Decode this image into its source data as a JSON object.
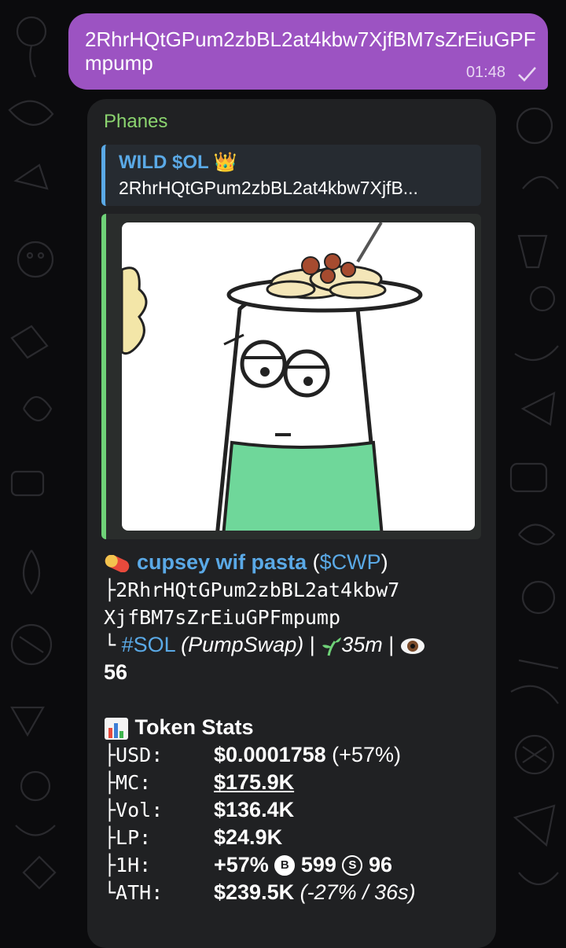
{
  "outgoing": {
    "text": "2RhrHQtGPum2zbBL2at4kbw7XjfBM7sZrEiuGPFmpump",
    "time": "01:48"
  },
  "incoming": {
    "sender": "Phanes",
    "reply": {
      "title": "WILD $OL",
      "title_emoji": "👑",
      "text": "2RhrHQtGPum2zbBL2at4kbw7XjfB..."
    },
    "token": {
      "name": "cupsey wif pasta",
      "ticker_open": "(",
      "ticker": "$CWP",
      "ticker_close": ")",
      "addr_prefix": "├",
      "address_line1": "2RhrHQtGPum2zbBL2at4kbw7",
      "address_line2": "XjfBM7sZrEiuGPFmpump",
      "chain_prefix": "└",
      "chain": "#SOL",
      "dex": "(PumpSwap)",
      "sep": "|",
      "age": "35m",
      "views": "56"
    },
    "stats": {
      "title": "Token Stats",
      "rows": [
        {
          "key": "├USD:",
          "value": "$0.0001758",
          "extra": "(+57%)"
        },
        {
          "key": "├MC:",
          "value": "$175.9K",
          "extra": ""
        },
        {
          "key": "├Vol:",
          "value": "$136.4K",
          "extra": ""
        },
        {
          "key": "├LP:",
          "value": "$24.9K",
          "extra": ""
        },
        {
          "key": "├1H:",
          "value": "+57%",
          "buys": "599",
          "sells": "96"
        },
        {
          "key": "└ATH:",
          "value": "$239.5K",
          "extra": "(-27% / 36s)"
        }
      ],
      "buy_icon": "B",
      "sell_icon": "S"
    }
  },
  "colors": {
    "outgoing_bubble": "#9c53c2",
    "incoming_bubble": "#202123",
    "sender": "#8bd46f",
    "link": "#5aa9e6",
    "preview_bar": "#6fd278"
  }
}
